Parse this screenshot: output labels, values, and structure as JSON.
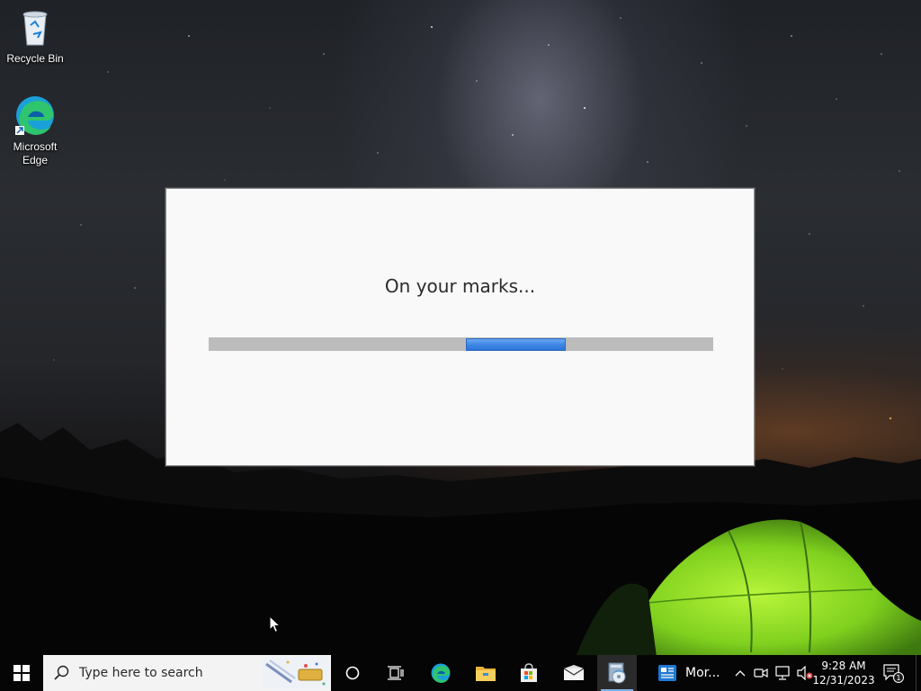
{
  "desktop": {
    "icons": [
      {
        "label": "Recycle Bin",
        "icon": "recycle-bin-icon"
      },
      {
        "label": "Microsoft Edge",
        "icon": "edge-icon"
      }
    ]
  },
  "dialog": {
    "message": "On your marks...",
    "progress": {
      "mode": "indeterminate",
      "accent": "#3f88e6",
      "track": "#bcbcbc"
    }
  },
  "taskbar": {
    "start": {
      "icon": "windows-logo-icon"
    },
    "search": {
      "placeholder": "Type here to search",
      "icon": "search-icon"
    },
    "buttons": [
      {
        "name": "cortana",
        "icon": "circle-icon"
      },
      {
        "name": "task-view",
        "icon": "task-view-icon"
      },
      {
        "name": "edge",
        "icon": "edge-icon"
      },
      {
        "name": "file-explorer",
        "icon": "folder-icon"
      },
      {
        "name": "microsoft-store",
        "icon": "store-bag-icon"
      },
      {
        "name": "mail",
        "icon": "envelope-icon"
      },
      {
        "name": "setup-app",
        "icon": "setup-disc-icon",
        "active": true
      }
    ],
    "news": {
      "label": "Mor...",
      "icon": "news-widget-icon"
    },
    "tray": {
      "icons": [
        "chevron-up-icon",
        "meet-now-icon",
        "network-icon",
        "volume-muted-icon"
      ],
      "time": "9:28 AM",
      "date": "12/31/2023",
      "notification_count": "1"
    }
  }
}
